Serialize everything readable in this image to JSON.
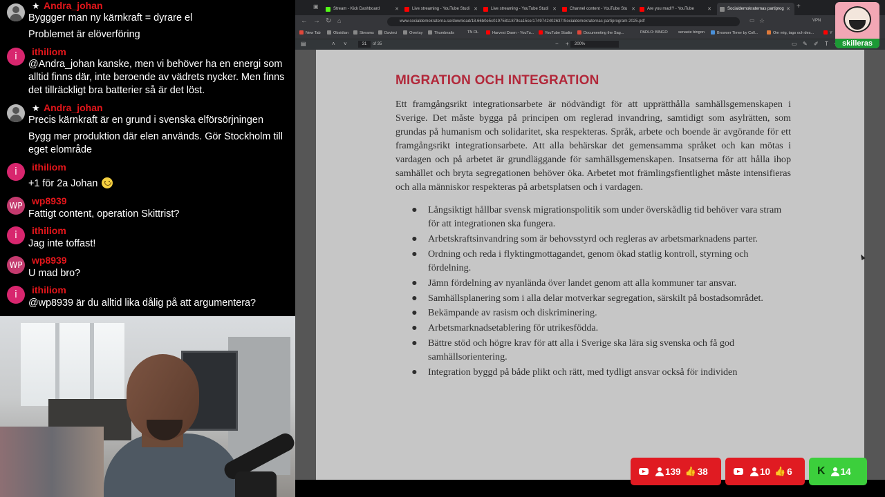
{
  "chat": {
    "messages": [
      {
        "user": "Andra_johan",
        "avatar": "profile-photo",
        "badge": "star",
        "lines": [
          "Byggger man ny kärnkraft = dyrare el",
          "Problemet är elöverföring"
        ]
      },
      {
        "user": "ithiliom",
        "avatar_letter": "i",
        "text": "@Andra_johan kanske, men vi behöver ha en energi som alltid finns där, inte beroende av vädrets nycker. Men finns det tillräckligt bra batterier så är det löst."
      },
      {
        "user": "Andra_johan",
        "avatar": "profile-photo",
        "badge": "star",
        "lines": [
          "Precis kärnkraft är en grund i svenska elförsörjningen",
          "Bygg mer produktion där elen används. Gör Stockholm till eget elområde"
        ]
      },
      {
        "user": "ithiliom",
        "avatar_letter": "i",
        "text": "+1 för 2a Johan",
        "emoji": "slightly-smiling-face"
      },
      {
        "user": "wp8939",
        "avatar_letter": "WP",
        "text": "Fattigt content, operation Skittrist?"
      },
      {
        "user": "ithiliom",
        "avatar_letter": "i",
        "text": "Jag inte toffast!"
      },
      {
        "user": "wp8939",
        "avatar_letter": "WP",
        "text": "U mad bro?"
      },
      {
        "user": "ithiliom",
        "avatar_letter": "i",
        "text": "@wp8939 är du alltid lika dålig på att argumentera?"
      }
    ],
    "colors": {
      "username": "#e5161b",
      "text": "#ffffff",
      "avatar_i": "#d8266e",
      "avatar_wp": "#c43a6e"
    }
  },
  "browser": {
    "tabs": [
      {
        "label": "Stream - Kick Dashboard",
        "icon": "kick-icon",
        "color": "#53fc18"
      },
      {
        "label": "Live streaming - YouTube Studi",
        "icon": "youtube-studio-icon",
        "color": "#ff0000"
      },
      {
        "label": "Live streaming - YouTube Studi",
        "icon": "youtube-studio-icon",
        "color": "#ff0000"
      },
      {
        "label": "Channel content - YouTube Stu",
        "icon": "youtube-studio-icon",
        "color": "#ff0000"
      },
      {
        "label": "Are you mad!? - YouTube",
        "icon": "youtube-icon",
        "color": "#ff0000"
      },
      {
        "label": "Socialdemokraternas partiprog",
        "icon": "pdf-icon",
        "color": "#888888",
        "active": true
      }
    ],
    "url": "www.socialdemokraterna.se/download/18.66b0e5c01975811879ca15ce/1749742402637/Socialdemokraternas partiprogram 2025.pdf",
    "vpn_label": "VPN",
    "bookmarks": [
      "New Tab",
      "Obsidian",
      "Streams",
      "Davinci",
      "Overlay",
      "Thumbnails",
      "TN DL",
      "Harvest Dawn - YouTu...",
      "YouTube Studio",
      "Documenting the Sag...",
      "PADLO: BINGO",
      "senaste bingon",
      "Browser Timer by Coll...",
      "Om mig, tags och des...",
      "Y"
    ],
    "pdf_toolbar": {
      "page_current": "31",
      "page_total": "of 35",
      "zoom": "200%"
    }
  },
  "document": {
    "heading": "MIGRATION OCH INTEGRATION",
    "heading_color": "#b2283a",
    "paragraph": "Ett framgångsrikt integrationsarbete är nödvändigt för att upprätthålla samhällsgemenskapen i Sverige. Det måste bygga på principen om reglerad invandring, samtidigt som asylrätten, som grundas på humanism och solidaritet, ska respekteras. Språk, arbete och boende är avgörande för ett framgångsrikt integrationsarbete. Att alla behärskar det gemensamma språket och kan mötas i vardagen och på arbetet är grundläggande för samhällsgemenskapen. Insatserna för att hålla ihop samhället och bryta segregationen behöver öka. Arbetet mot främlingsfientlighet måste intensifieras och alla människor respekteras på arbetsplatsen och i vardagen.",
    "bullets": [
      "Långsiktigt hållbar svensk migrationspolitik som under överskådlig tid behöver vara stram för att integrationen ska fungera.",
      "Arbetskraftsinvandring som är behovsstyrd och regleras av arbetsmarknadens parter.",
      "Ordning och reda i flyktingmottagandet, genom ökad statlig kontroll, styrning och fördelning.",
      "Jämn fördelning av nyanlända över landet genom att alla kommuner tar ansvar.",
      "Samhällsplanering som i alla delar motverkar segregation, särskilt på bostadsområdet.",
      "Bekämpande av rasism och diskriminering.",
      "Arbetsmarknadsetablering för utrikesfödda.",
      "Bättre stöd och högre krav för att alla i Sverige ska lära sig svenska och få god samhällsorientering.",
      "Integration byggd på både plikt och rätt, med tydligt ansvar också för individen"
    ]
  },
  "overlay": {
    "logo_label": "skilleras",
    "badges": [
      {
        "platform": "youtube",
        "viewers": "139",
        "likes": "38",
        "color": "#e01b22"
      },
      {
        "platform": "youtube",
        "viewers": "10",
        "likes": "6",
        "color": "#e01b22"
      },
      {
        "platform": "kick",
        "viewers": "14",
        "color": "#3ccf3c"
      }
    ]
  }
}
